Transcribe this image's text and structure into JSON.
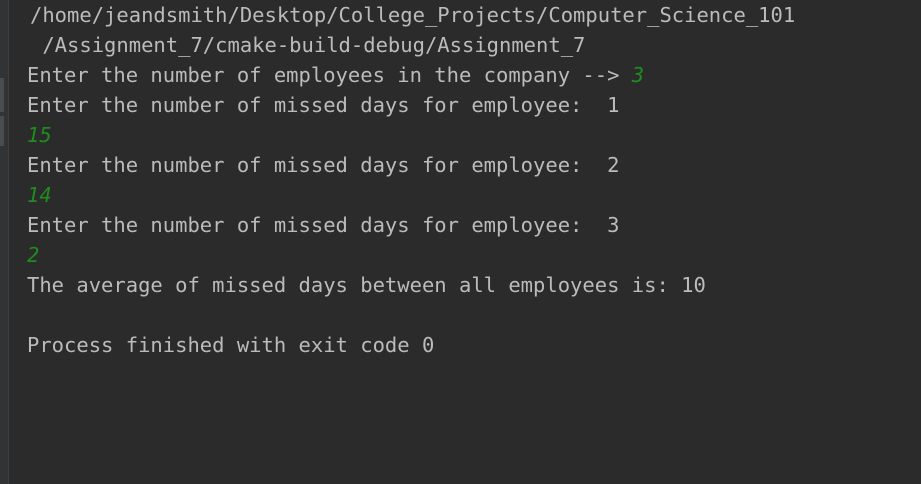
{
  "console": {
    "path_line_1": "/home/jeandsmith/Desktop/College_Projects/Computer_Science_101",
    "path_line_2": " /Assignment_7/cmake-build-debug/Assignment_7",
    "prompt_employees": "Enter the number of employees in the company --> ",
    "input_employees": "3",
    "prompt_missed_1": "Enter the number of missed days for employee:  1",
    "input_missed_1": "15",
    "prompt_missed_2": "Enter the number of missed days for employee:  2",
    "input_missed_2": "14",
    "prompt_missed_3": "Enter the number of missed days for employee:  3",
    "input_missed_3": "2",
    "average_line": "The average of missed days between all employees is: 10",
    "exit_line": "Process finished with exit code 0"
  },
  "colors": {
    "background": "#2b2b2b",
    "output_text": "#bbbbbb",
    "user_input": "#1f8c1f"
  }
}
